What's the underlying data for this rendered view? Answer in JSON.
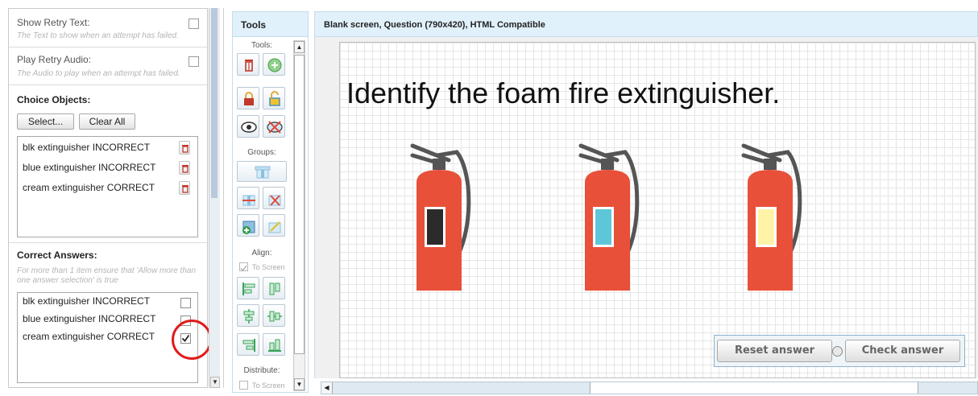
{
  "left_panel": {
    "show_retry_text": {
      "label": "Show Retry Text:",
      "hint": "The Text to show when an attempt has failed."
    },
    "play_retry_audio": {
      "label": "Play Retry Audio:",
      "hint": "The Audio to play when an attempt has failed."
    },
    "choice_objects": {
      "title": "Choice Objects:",
      "select_label": "Select...",
      "clear_label": "Clear All",
      "items": [
        "blk extinguisher INCORRECT",
        "blue extinguisher INCORRECT",
        "cream extinguisher CORRECT"
      ]
    },
    "correct_answers": {
      "title": "Correct Answers:",
      "hint": "For more than 1 item ensure that 'Allow more than one answer selection' is true",
      "items": [
        {
          "label": "blk extinguisher INCORRECT",
          "checked": false
        },
        {
          "label": "blue extinguisher INCORRECT",
          "checked": false
        },
        {
          "label": "cream extinguisher CORRECT",
          "checked": true
        }
      ]
    }
  },
  "tools_panel": {
    "title": "Tools",
    "tools_label": "Tools:",
    "groups_label": "Groups:",
    "align_label": "Align:",
    "to_screen_label": "To Screen",
    "distribute_label": "Distribute:",
    "icons": [
      "trash-icon",
      "add-icon",
      "lock-icon",
      "unlock-icon",
      "eye-icon",
      "hide-icon",
      "group-icon",
      "ungroup-icon",
      "remove-from-group-icon",
      "add-to-group-icon",
      "edit-group-icon",
      "align-left-icon",
      "align-center-horizontal-icon",
      "align-center-icon",
      "align-middle-icon",
      "align-right-icon",
      "align-bottom-icon"
    ]
  },
  "stage": {
    "title": "Blank screen, Question (790x420), HTML Compatible",
    "question": "Identify the foam fire extinguisher.",
    "extinguishers": [
      {
        "name": "blk extinguisher",
        "label_color": "#2b2b2b"
      },
      {
        "name": "blue extinguisher",
        "label_color": "#5ec6d9"
      },
      {
        "name": "cream extinguisher",
        "label_color": "#fff3a8"
      }
    ],
    "reset_label": "Reset answer",
    "check_label": "Check answer"
  },
  "colors": {
    "header_bg": "#e1f1fb",
    "extinguisher_body": "#e8503a",
    "hose": "#555555",
    "highlight": "#e11b1b"
  }
}
